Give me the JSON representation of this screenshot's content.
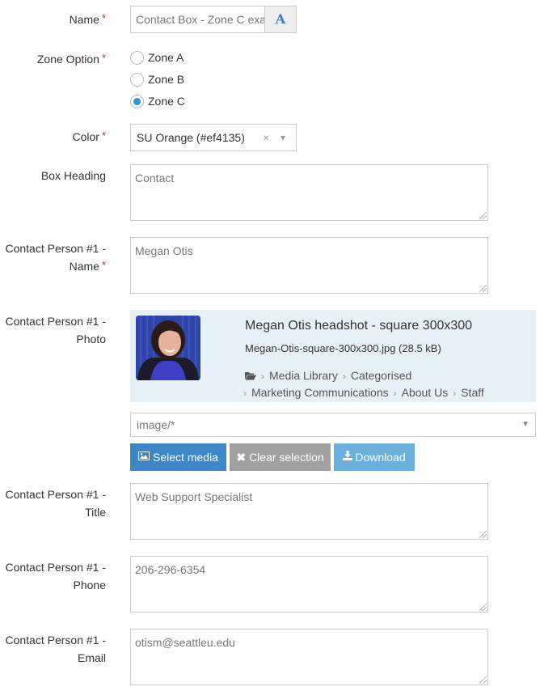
{
  "form": {
    "name": {
      "label": "Name",
      "required_mark": "*",
      "value": "Contact Box - Zone C exa",
      "addon_icon": "font-style-icon",
      "addon_glyph": "A"
    },
    "zone_option": {
      "label": "Zone Option",
      "required_mark": "*",
      "options": [
        {
          "label": "Zone A",
          "checked": false
        },
        {
          "label": "Zone B",
          "checked": false
        },
        {
          "label": "Zone C",
          "checked": true
        }
      ]
    },
    "color": {
      "label": "Color",
      "required_mark": "*",
      "selected": "SU Orange (#ef4135)",
      "clear_glyph": "×",
      "arrow_glyph": "▾"
    },
    "box_heading": {
      "label": "Box Heading",
      "value": "Contact"
    },
    "contact_name": {
      "label_line1": "Contact Person #1 -",
      "label_line2": "Name",
      "required_mark": "*",
      "value": "Megan Otis"
    },
    "contact_photo": {
      "label_line1": "Contact Person #1 -",
      "label_line2": "Photo",
      "media_title": "Megan Otis headshot - square 300x300",
      "file_info": "Megan-Otis-square-300x300.jpg (28.5 kB)",
      "folder_icon": "folder-open-icon",
      "breadcrumb": [
        "Media Library",
        "Categorised",
        "Marketing Communications",
        "About Us",
        "Staff"
      ],
      "crumb_sep": "›",
      "type_filter": "image/*",
      "type_filter_arrow": "▼",
      "buttons": {
        "select": "Select media",
        "clear": "Clear selection",
        "download": "Download"
      }
    },
    "contact_title": {
      "label_line1": "Contact Person #1 -",
      "label_line2": "Title",
      "value": "Web Support Specialist"
    },
    "contact_phone": {
      "label_line1": "Contact Person #1 -",
      "label_line2": "Phone",
      "value": "206-296-6354"
    },
    "contact_email": {
      "label_line1": "Contact Person #1 -",
      "label_line2": "Email",
      "value": "otism@seattleu.edu"
    }
  },
  "colors": {
    "primary": "#3d87c8",
    "secondary": "#a0a0a0",
    "info": "#6ab0de",
    "radio_checked": "#2a96d4",
    "required": "#c9302c",
    "media_panel_bg": "#e6f0f7"
  }
}
